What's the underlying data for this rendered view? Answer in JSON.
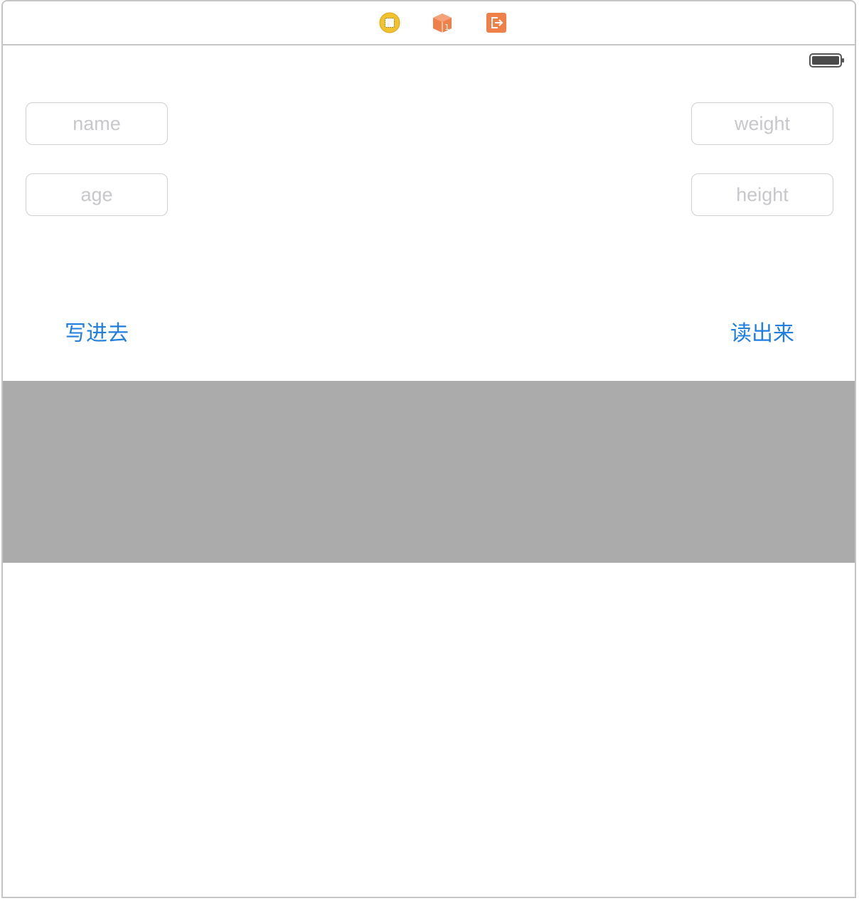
{
  "scene_dock": {
    "icons": [
      {
        "name": "view-controller-icon",
        "color": "#f2c12e"
      },
      {
        "name": "first-responder-icon",
        "color": "#f08049",
        "badge": "1"
      },
      {
        "name": "exit-icon",
        "color": "#f08049"
      }
    ]
  },
  "status_bar": {
    "battery_icon": "battery-icon"
  },
  "form": {
    "name_placeholder": "name",
    "age_placeholder": "age",
    "weight_placeholder": "weight",
    "height_placeholder": "height"
  },
  "buttons": {
    "write_label": "写进去",
    "read_label": "读出来"
  },
  "colors": {
    "accent": "#1f7ee0",
    "gray_view": "#ababab",
    "placeholder": "#c7c7cc",
    "border": "#c4c4c4"
  }
}
